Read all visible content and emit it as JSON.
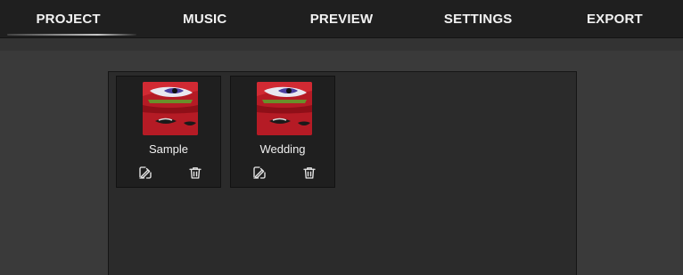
{
  "nav": {
    "tabs": [
      {
        "label": "PROJECT",
        "active": true
      },
      {
        "label": "MUSIC",
        "active": false
      },
      {
        "label": "PREVIEW",
        "active": false
      },
      {
        "label": "SETTINGS",
        "active": false
      },
      {
        "label": "EXPORT",
        "active": false
      }
    ]
  },
  "projects": [
    {
      "name": "Sample",
      "edit_icon": "edit-icon",
      "delete_icon": "trash-icon"
    },
    {
      "name": "Wedding",
      "edit_icon": "edit-icon",
      "delete_icon": "trash-icon"
    }
  ],
  "colors": {
    "nav_bg": "#1f1f1f",
    "app_bg": "#3a3a3a",
    "panel_bg": "#2b2b2b",
    "card_bg": "#1f1f1f",
    "text": "#f0f0f0",
    "thumb_red": "#b51b25"
  }
}
